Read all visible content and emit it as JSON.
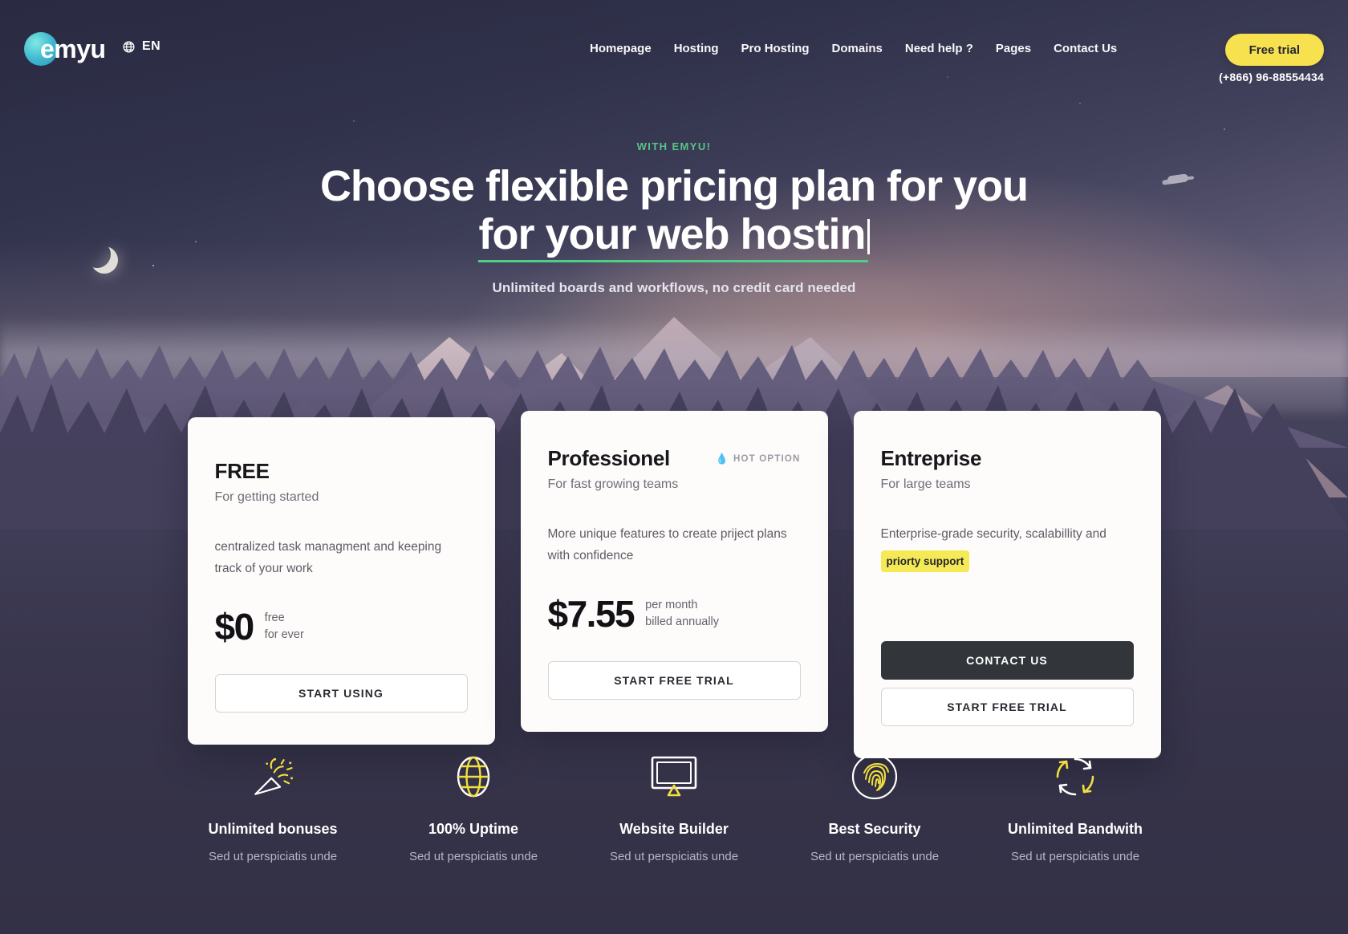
{
  "brand": {
    "logo_text": "emyu",
    "logo_icon": "orb-icon"
  },
  "header": {
    "language": {
      "code": "EN",
      "icon": "globe-icon"
    },
    "nav": [
      {
        "label": "Homepage"
      },
      {
        "label": "Hosting"
      },
      {
        "label": "Pro Hosting"
      },
      {
        "label": "Domains"
      },
      {
        "label": "Need help ?"
      },
      {
        "label": "Pages"
      },
      {
        "label": "Contact Us"
      }
    ],
    "cta_label": "Free trial",
    "phone": "(+866) 96-88554434"
  },
  "hero": {
    "eyebrow": "WITH EMYU!",
    "title_line1": "Choose flexible pricing plan for you",
    "title_line2": "for your web hostin",
    "subtitle": "Unlimited boards and workflows, no credit card needed"
  },
  "pricing": {
    "plans": [
      {
        "name": "FREE",
        "tagline": "For getting started",
        "description": "centralized task managment and keeping track of your work",
        "price": "$0",
        "price_meta_line1": "free",
        "price_meta_line2": "for ever",
        "badge": "",
        "buttons": [
          {
            "label": "START USING",
            "style": "ghost"
          }
        ]
      },
      {
        "name": "Professionel",
        "tagline": "For fast growing teams",
        "description": "More unique features to create priject plans with confidence",
        "price": "$7.55",
        "price_meta_line1": "per month",
        "price_meta_line2": "billed annually",
        "badge": "HOT OPTION",
        "badge_icon": "flame-icon",
        "buttons": [
          {
            "label": "START FREE TRIAL",
            "style": "ghost"
          }
        ]
      },
      {
        "name": "Entreprise",
        "tagline": "For large teams",
        "description": "Enterprise-grade security, scalabillity and",
        "highlight": "priorty support",
        "price": "",
        "price_meta_line1": "",
        "price_meta_line2": "",
        "badge": "",
        "buttons": [
          {
            "label": "CONTACT US",
            "style": "dark"
          },
          {
            "label": "START FREE TRIAL",
            "style": "ghost"
          }
        ]
      }
    ]
  },
  "features": [
    {
      "title": "Unlimited bonuses",
      "subtitle": "Sed ut perspiciatis unde",
      "icon": "party-popper-icon"
    },
    {
      "title": "100% Uptime",
      "subtitle": "Sed ut perspiciatis unde",
      "icon": "globe-icon"
    },
    {
      "title": "Website Builder",
      "subtitle": "Sed ut perspiciatis unde",
      "icon": "monitor-icon"
    },
    {
      "title": "Best Security",
      "subtitle": "Sed ut perspiciatis unde",
      "icon": "fingerprint-icon"
    },
    {
      "title": "Unlimited Bandwith",
      "subtitle": "Sed ut perspiciatis unde",
      "icon": "refresh-cycle-icon"
    }
  ],
  "colors": {
    "accent_yellow": "#f7e14e",
    "accent_green": "#4ecf86",
    "dark_button": "#32363a",
    "page_bg": "#3c3c55",
    "card_bg": "#fdfcfa"
  }
}
